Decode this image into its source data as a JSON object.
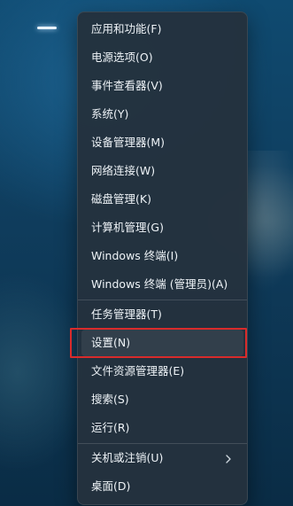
{
  "menu": {
    "items": [
      {
        "label": "应用和功能(F)"
      },
      {
        "label": "电源选项(O)"
      },
      {
        "label": "事件查看器(V)"
      },
      {
        "label": "系统(Y)"
      },
      {
        "label": "设备管理器(M)"
      },
      {
        "label": "网络连接(W)"
      },
      {
        "label": "磁盘管理(K)"
      },
      {
        "label": "计算机管理(G)"
      },
      {
        "label": "Windows 终端(I)"
      },
      {
        "label": "Windows 终端 (管理员)(A)"
      },
      {
        "label": "任务管理器(T)"
      },
      {
        "label": "设置(N)"
      },
      {
        "label": "文件资源管理器(E)"
      },
      {
        "label": "搜索(S)"
      },
      {
        "label": "运行(R)"
      },
      {
        "label": "关机或注销(U)"
      },
      {
        "label": "桌面(D)"
      }
    ],
    "selected_label": "设置(N)"
  },
  "icons": {
    "submenu_arrow": "chevron-right-icon"
  },
  "colors": {
    "highlight_border": "#d92b2b",
    "menu_background": "#24323e",
    "text": "#eef3f7"
  }
}
